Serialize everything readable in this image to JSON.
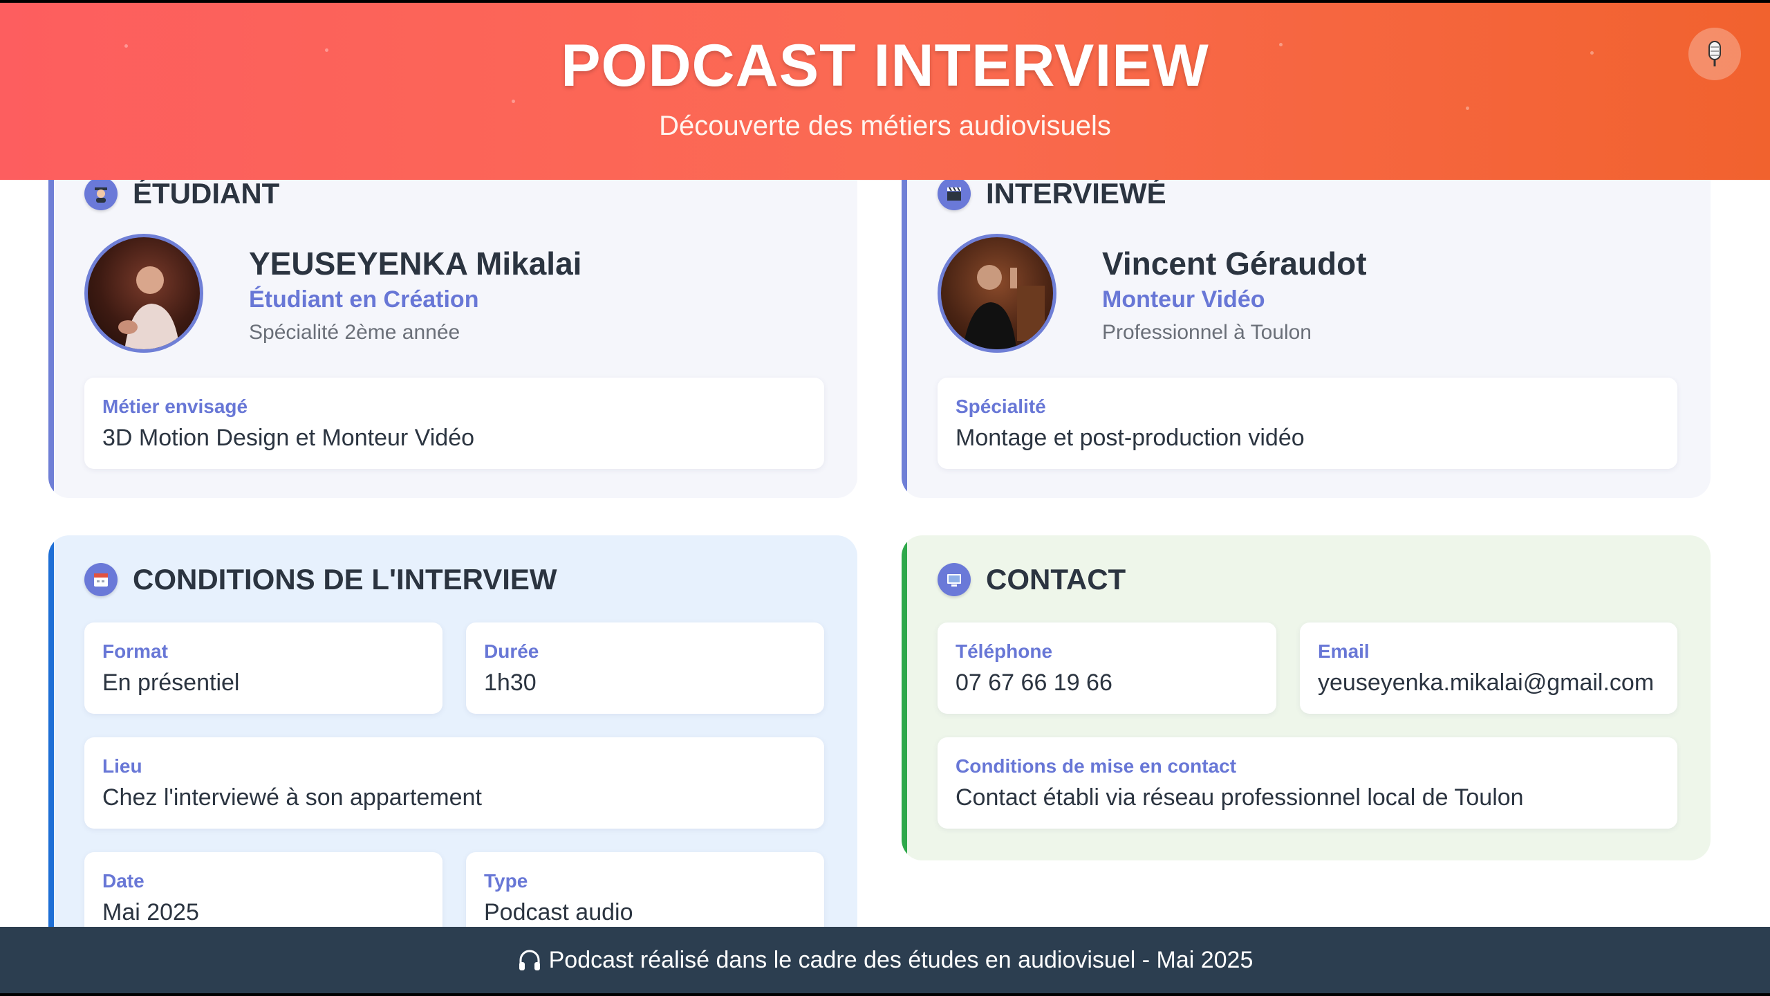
{
  "header": {
    "title": "PODCAST INTERVIEW",
    "subtitle": "Découverte des métiers audiovisuels",
    "mic_icon": "microphone-icon"
  },
  "student": {
    "section_title": "ÉTUDIANT",
    "section_icon": "student-icon",
    "name": "YEUSEYENKA Mikalai",
    "role": "Étudiant en Création",
    "detail": "Spécialité 2ème année",
    "info": {
      "label": "Métier envisagé",
      "value": "3D Motion Design et Monteur Vidéo"
    }
  },
  "interviewee": {
    "section_title": "INTERVIEWÉ",
    "section_icon": "clapperboard-icon",
    "name": "Vincent Géraudot",
    "role": "Monteur Vidéo",
    "detail": "Professionnel à Toulon",
    "info": {
      "label": "Spécialité",
      "value": "Montage et post-production vidéo"
    }
  },
  "conditions": {
    "section_title": "CONDITIONS DE L'INTERVIEW",
    "section_icon": "calendar-icon",
    "format": {
      "label": "Format",
      "value": "En présentiel"
    },
    "duration": {
      "label": "Durée",
      "value": "1h30"
    },
    "place": {
      "label": "Lieu",
      "value": "Chez l'interviewé à son appartement"
    },
    "date": {
      "label": "Date",
      "value": "Mai 2025"
    },
    "type": {
      "label": "Type",
      "value": "Podcast audio"
    }
  },
  "contact": {
    "section_title": "CONTACT",
    "section_icon": "computer-icon",
    "phone": {
      "label": "Téléphone",
      "value": "07 67 66 19 66"
    },
    "email": {
      "label": "Email",
      "value": "yeuseyenka.mikalai@gmail.com"
    },
    "conditions": {
      "label": "Conditions de mise en contact",
      "value": "Contact établi via réseau professionnel local de Toulon"
    }
  },
  "footer": {
    "icon": "headphones-icon",
    "text": "Podcast réalisé dans le cadre des études en audiovisuel - Mai 2025"
  },
  "colors": {
    "header_start": "#fd5e5f",
    "header_end": "#f1622e",
    "accent_purple": "#6877d6",
    "accent_blue": "#1e6fd6",
    "accent_green": "#2ea84a",
    "footer_bg": "#2c3e50"
  }
}
